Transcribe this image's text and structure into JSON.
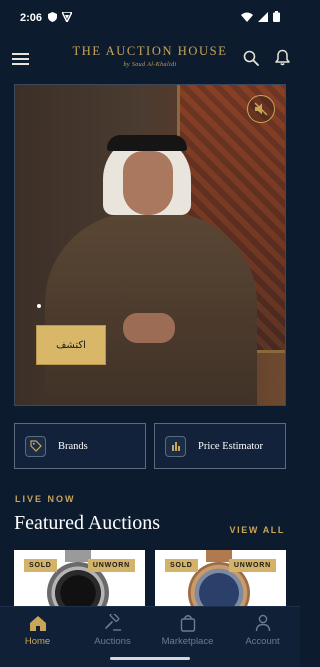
{
  "status_bar": {
    "time": "2:06",
    "icons": [
      "shield-icon",
      "vpn-icon",
      "wifi-icon",
      "signal-icon",
      "battery-icon"
    ]
  },
  "header": {
    "title": "THE AUCTION HOUSE",
    "subtitle": "by Saud Al-Khalidi",
    "icons": [
      "menu-icon",
      "search-icon",
      "bell-icon"
    ]
  },
  "hero": {
    "cta_label": "اكتشف",
    "mute_icon": "volume-muted-icon"
  },
  "quick_links": [
    {
      "label": "Brands",
      "icon": "tag-icon"
    },
    {
      "label": "Price Estimator",
      "icon": "bar-chart-icon"
    }
  ],
  "section": {
    "eyebrow": "LIVE NOW",
    "title": "Featured Auctions",
    "view_all": "VIEW ALL"
  },
  "cards": [
    {
      "badge_left": "SOLD",
      "badge_right": "UNWORN"
    },
    {
      "badge_left": "SOLD",
      "badge_right": "UNWORN"
    }
  ],
  "bottom_nav": [
    {
      "label": "Home",
      "icon": "home-icon",
      "active": true
    },
    {
      "label": "Auctions",
      "icon": "gavel-icon",
      "active": false
    },
    {
      "label": "Marketplace",
      "icon": "shopping-bag-icon",
      "active": false
    },
    {
      "label": "Account",
      "icon": "user-icon",
      "active": false
    }
  ],
  "colors": {
    "background": "#0d1b2e",
    "accent_gold": "#c9a55a",
    "cta_gold": "#d8b868",
    "nav_inactive": "#6b7d93"
  }
}
